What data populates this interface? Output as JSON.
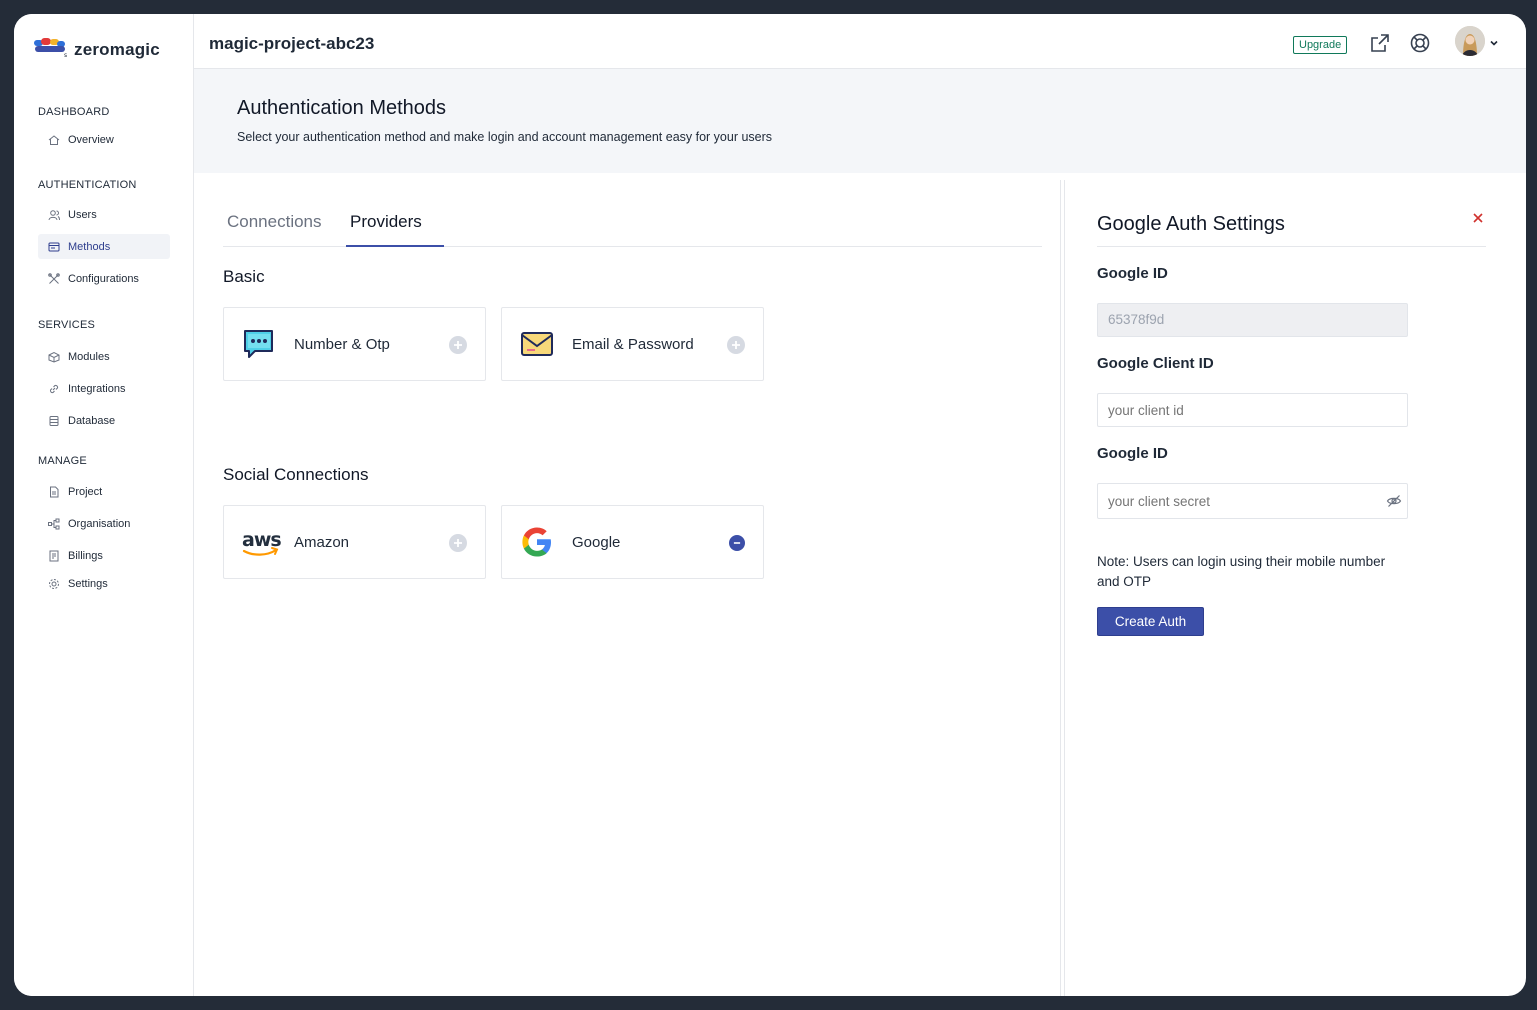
{
  "brand": {
    "name": "zeromagic"
  },
  "topbar": {
    "project": "magic-project-abc23",
    "upgrade_label": "Upgrade"
  },
  "sidebar": {
    "sections": [
      {
        "title": "DASHBOARD",
        "items": [
          {
            "label": "Overview",
            "icon": "home-icon"
          }
        ]
      },
      {
        "title": "AUTHENTICATION",
        "items": [
          {
            "label": "Users",
            "icon": "users-icon"
          },
          {
            "label": "Methods",
            "icon": "methods-icon",
            "active": true
          },
          {
            "label": "Configurations",
            "icon": "tools-icon"
          }
        ]
      },
      {
        "title": "SERVICES",
        "items": [
          {
            "label": "Modules",
            "icon": "modules-icon"
          },
          {
            "label": "Integrations",
            "icon": "link-icon"
          },
          {
            "label": "Database",
            "icon": "database-icon"
          }
        ]
      },
      {
        "title": "MANAGE",
        "items": [
          {
            "label": "Project",
            "icon": "file-icon"
          },
          {
            "label": "Organisation",
            "icon": "org-icon"
          },
          {
            "label": "Billings",
            "icon": "billing-icon"
          },
          {
            "label": "Settings",
            "icon": "gear-icon"
          }
        ]
      }
    ]
  },
  "header": {
    "title": "Authentication Methods",
    "subtitle": "Select your authentication method and make login and account management easy for your users"
  },
  "tabs": [
    {
      "label": "Connections",
      "active": false
    },
    {
      "label": "Providers",
      "active": true
    }
  ],
  "basic": {
    "title": "Basic",
    "cards": [
      {
        "label": "Number & Otp",
        "icon": "chat-bubble-icon",
        "action": "add"
      },
      {
        "label": "Email & Password",
        "icon": "envelope-icon",
        "action": "add"
      }
    ]
  },
  "social": {
    "title": "Social Connections",
    "cards": [
      {
        "label": "Amazon",
        "icon": "aws-logo-icon",
        "action": "add"
      },
      {
        "label": "Google",
        "icon": "google-logo-icon",
        "action": "remove"
      }
    ]
  },
  "panel": {
    "title": "Google Auth Settings",
    "fields": [
      {
        "label": "Google ID",
        "value": "65378f9d",
        "disabled": true
      },
      {
        "label": "Google Client ID",
        "placeholder": "your client id"
      },
      {
        "label": "Google ID",
        "placeholder": "your client secret"
      }
    ],
    "note": "Note: Users can login using their mobile number and OTP",
    "submit_label": "Create Auth"
  },
  "colors": {
    "accent": "#3c4fa8",
    "upgrade": "#10795a",
    "close": "#d0312d"
  }
}
